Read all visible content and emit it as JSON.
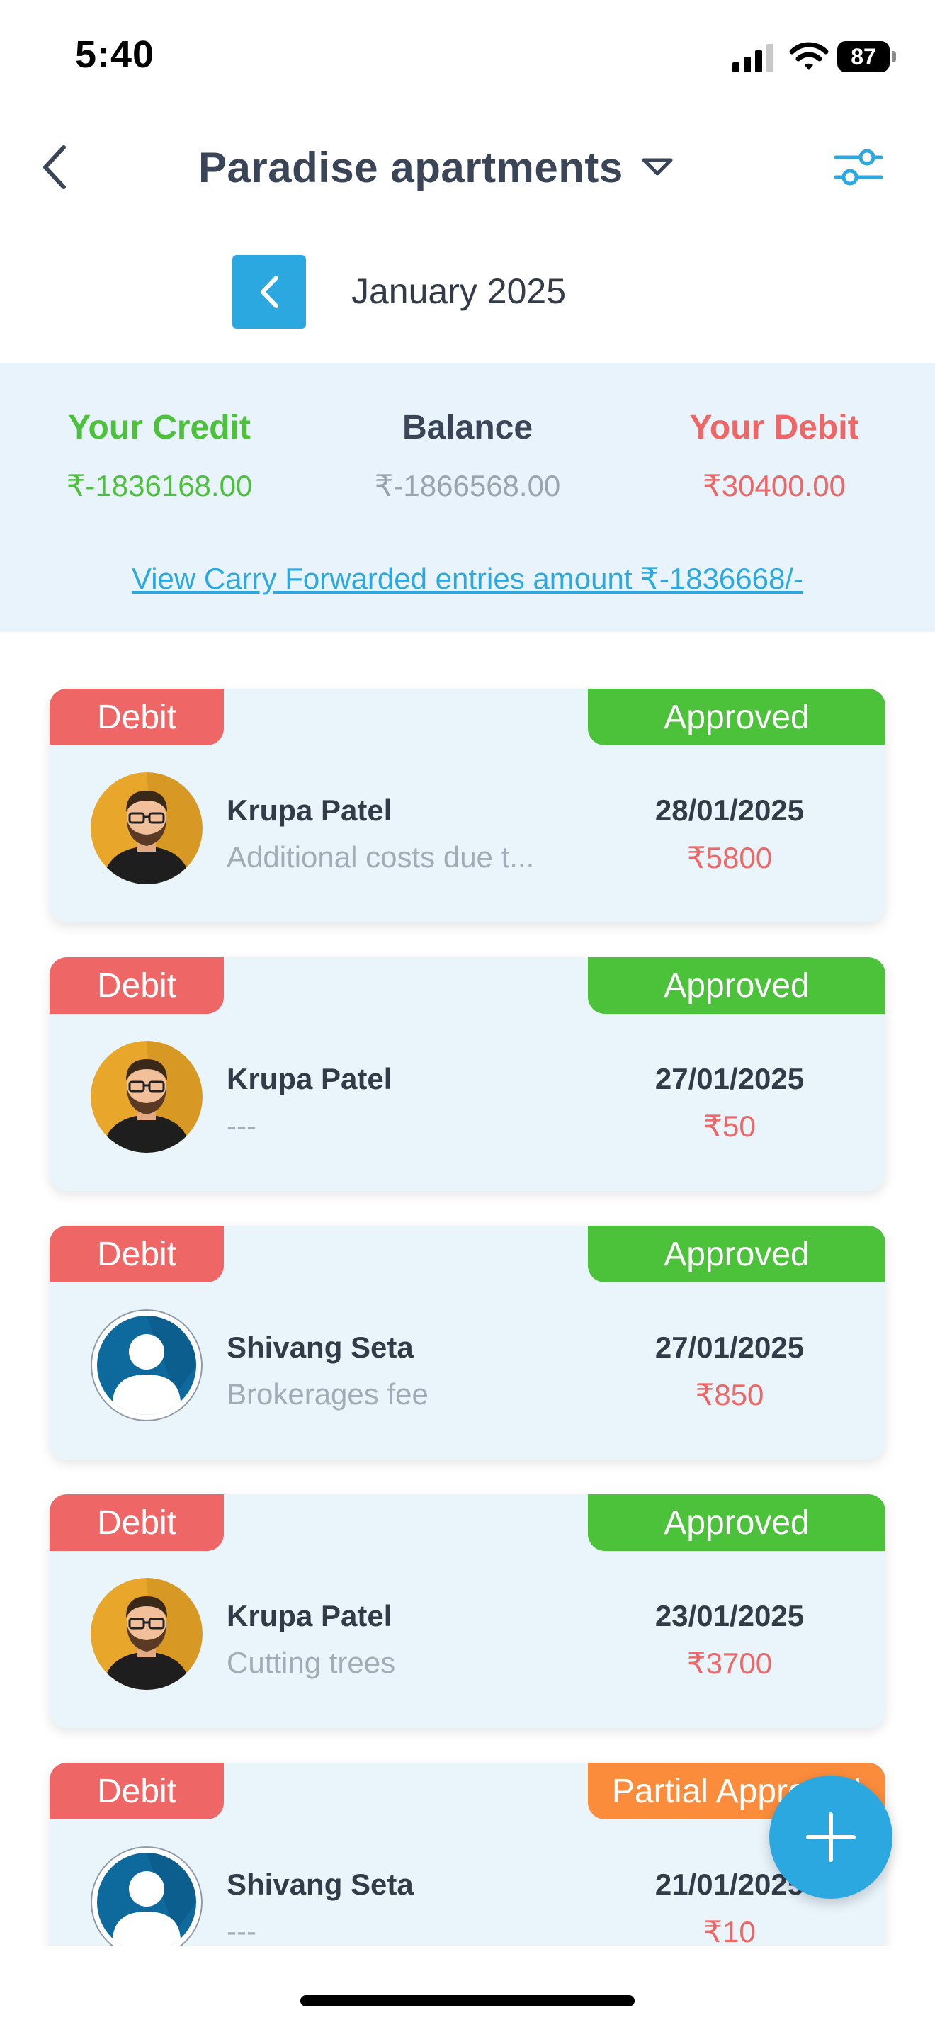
{
  "status_bar": {
    "time": "5:40",
    "battery": "87"
  },
  "header": {
    "title": "Paradise apartments"
  },
  "month_nav": {
    "label": "January 2025"
  },
  "summary": {
    "credit_label": "Your Credit",
    "credit_value": "₹-1836168.00",
    "balance_label": "Balance",
    "balance_value": "₹-1866568.00",
    "debit_label": "Your Debit",
    "debit_value": "₹30400.00",
    "carry_link": "View Carry Forwarded entries amount ₹-1836668/-"
  },
  "entries": [
    {
      "type": "Debit",
      "status": "Approved",
      "name": "Krupa Patel",
      "desc": "Additional costs due t...",
      "date": "28/01/2025",
      "amount": "₹5800",
      "avatar": "man-avatar"
    },
    {
      "type": "Debit",
      "status": "Approved",
      "name": "Krupa Patel",
      "desc": "---",
      "date": "27/01/2025",
      "amount": "₹50",
      "avatar": "man-avatar"
    },
    {
      "type": "Debit",
      "status": "Approved",
      "name": "Shivang Seta",
      "desc": "Brokerages fee",
      "date": "27/01/2025",
      "amount": "₹850",
      "avatar": "user-avatar"
    },
    {
      "type": "Debit",
      "status": "Approved",
      "name": "Krupa Patel",
      "desc": "Cutting trees",
      "date": "23/01/2025",
      "amount": "₹3700",
      "avatar": "man-avatar"
    },
    {
      "type": "Debit",
      "status": "Partial Approved",
      "name": "Shivang Seta",
      "desc": "---",
      "date": "21/01/2025",
      "amount": "₹10",
      "avatar": "user-avatar"
    }
  ],
  "icons": {
    "back": "chevron-left-icon",
    "dropdown": "caret-down-icon",
    "filter": "sliders-icon",
    "month_prev": "chevron-left-icon",
    "fab": "plus-icon"
  },
  "colors": {
    "accent": "#2ca8e0",
    "credit": "#4cc23a",
    "debit": "#ee6666",
    "approved": "#4cc23a",
    "partial": "#fb8c3c",
    "summary_bg": "#e8f3fb",
    "card_bg": "#e9f4fb"
  }
}
